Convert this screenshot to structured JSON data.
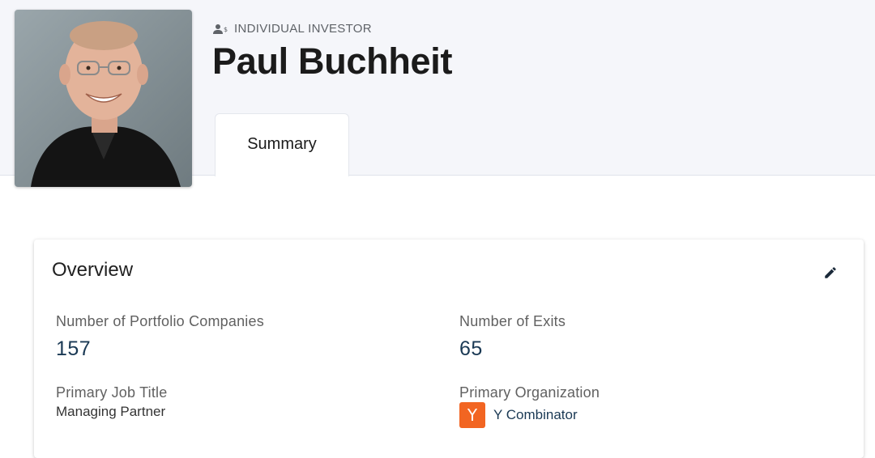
{
  "profile": {
    "entity_type": "INDIVIDUAL INVESTOR",
    "entity_type_icon": "investor-person-dollar-icon",
    "name": "Paul Buchheit",
    "photo": "profile-photo"
  },
  "tabs": [
    {
      "label": "Summary",
      "active": true
    }
  ],
  "overview": {
    "title": "Overview",
    "edit_icon": "pencil-icon",
    "fields": {
      "portfolio_companies": {
        "label": "Number of Portfolio Companies",
        "value": "157"
      },
      "exits": {
        "label": "Number of Exits",
        "value": "65"
      },
      "job_title": {
        "label": "Primary Job Title",
        "value": "Managing Partner"
      },
      "organization": {
        "label": "Primary Organization",
        "value": "Y Combinator",
        "logo_letter": "Y",
        "logo_color": "#f26522"
      }
    }
  },
  "colors": {
    "header_background": "#f5f6fa",
    "value_text": "#1a3954",
    "accent_orange": "#f26522"
  }
}
